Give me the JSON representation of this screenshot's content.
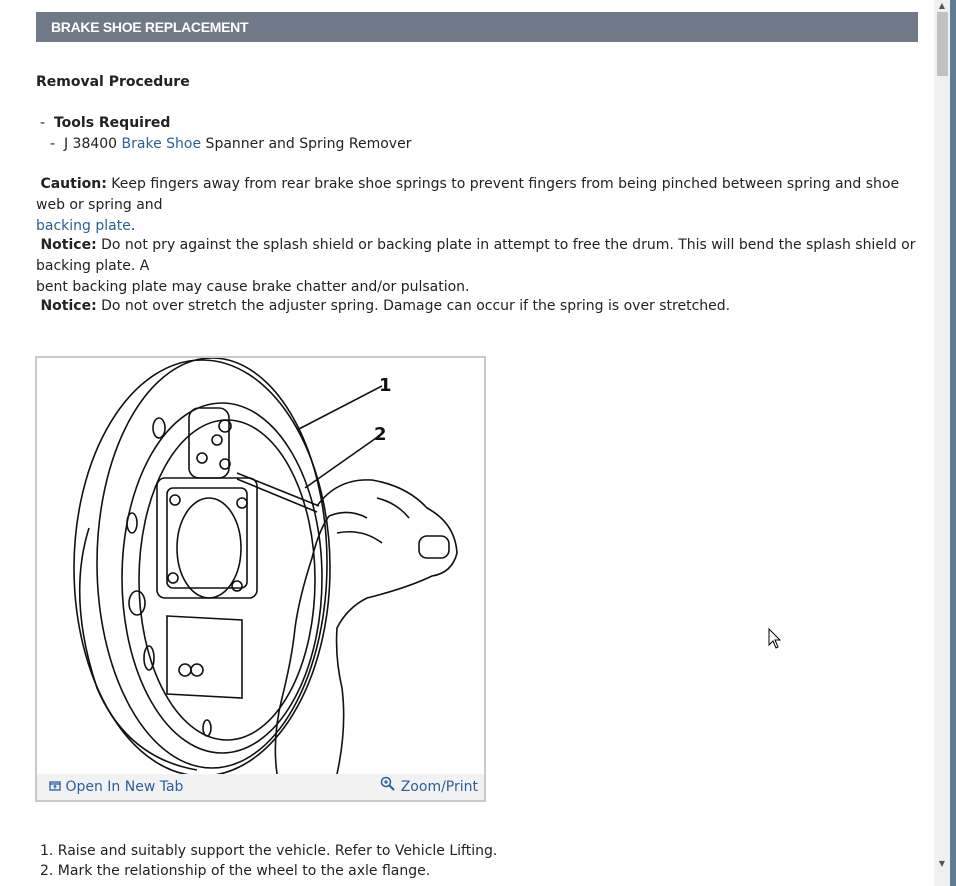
{
  "header": {
    "title": "BRAKE SHOE REPLACEMENT"
  },
  "removal": {
    "heading": "Removal Procedure"
  },
  "tools": {
    "bullet": "-",
    "heading": "Tools Required",
    "item_bullet": "-",
    "item_prefix": "J 38400 ",
    "item_link": "Brake Shoe",
    "item_suffix": " Spanner and Spring Remover"
  },
  "caution": {
    "label": "Caution:",
    "text": " Keep fingers away from rear brake shoe springs to prevent fingers from being pinched between spring and shoe web or spring and",
    "link": "backing plate",
    "end": "."
  },
  "notice1": {
    "label": "Notice:",
    "line1": " Do not pry against the splash shield or backing plate in attempt to free the drum. This will bend the splash shield or backing plate. A",
    "line2": "bent backing plate may cause brake chatter and/or pulsation."
  },
  "notice2": {
    "label": "Notice:",
    "text": " Do not over stretch the adjuster spring. Damage can occur if the spring is over stretched."
  },
  "figure": {
    "callout_1": "1",
    "callout_2": "2",
    "open_label": "Open In New Tab",
    "zoom_label": "Zoom/Print",
    "open_icon": "open-in-new-tab-icon",
    "zoom_icon": "magnifier-zoom-icon"
  },
  "steps": [
    "1. Raise and suitably support the vehicle. Refer to Vehicle Lifting.",
    "2. Mark the relationship of the wheel to the axle flange."
  ],
  "colors": {
    "header_bg": "#707987",
    "link": "#2b5f9b",
    "desktop": "#5e7c92"
  }
}
